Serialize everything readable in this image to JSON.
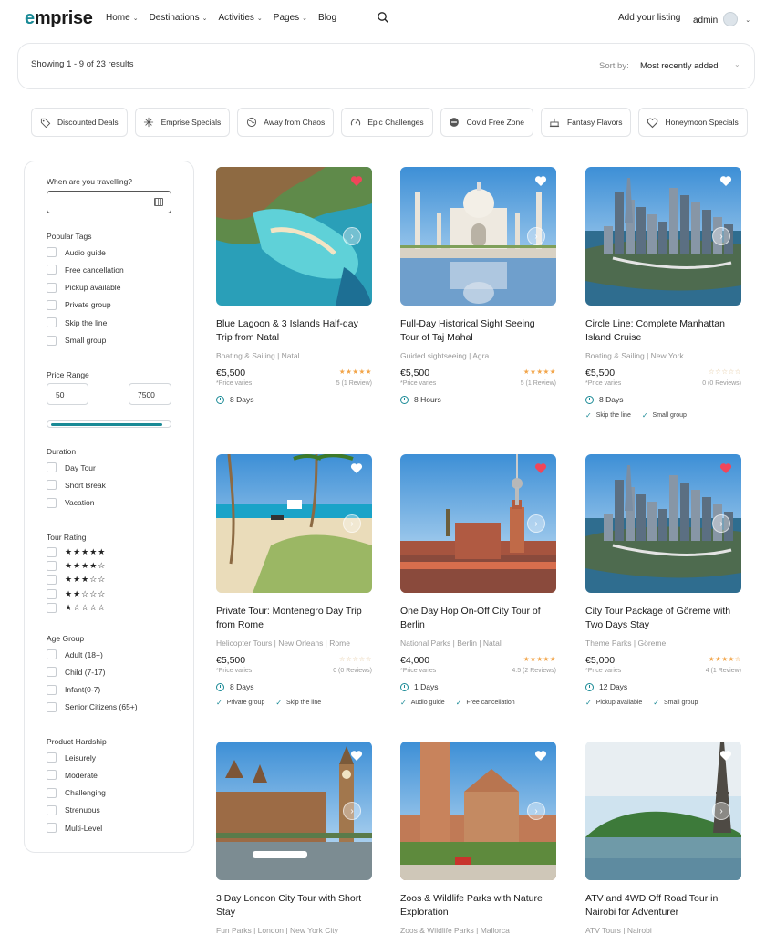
{
  "header": {
    "logo": "emprise",
    "nav": [
      "Home",
      "Destinations",
      "Activities",
      "Pages",
      "Blog"
    ],
    "nav_has_dropdown": [
      true,
      true,
      true,
      true,
      false
    ],
    "add_listing": "Add your listing",
    "user": "admin"
  },
  "results": {
    "summary": "Showing 1 - 9 of 23 results",
    "sort_label": "Sort by:",
    "sort_value": "Most recently added"
  },
  "categories": [
    {
      "label": "Discounted Deals",
      "icon": "tag-icon"
    },
    {
      "label": "Emprise Specials",
      "icon": "sparkle-icon"
    },
    {
      "label": "Away from Chaos",
      "icon": "globe-icon"
    },
    {
      "label": "Epic Challenges",
      "icon": "gauge-icon"
    },
    {
      "label": "Covid Free Zone",
      "icon": "no-entry-icon"
    },
    {
      "label": "Fantasy Flavors",
      "icon": "cake-icon"
    },
    {
      "label": "Honeymoon Specials",
      "icon": "heart-icon"
    }
  ],
  "sidebar": {
    "travel_label": "When are you travelling?",
    "tags_label": "Popular Tags",
    "tags": [
      "Audio guide",
      "Free cancellation",
      "Pickup available",
      "Private group",
      "Skip the line",
      "Small group"
    ],
    "price_label": "Price Range",
    "price_min": "50",
    "price_max": "7500",
    "duration_label": "Duration",
    "durations": [
      "Day Tour",
      "Short Break",
      "Vacation"
    ],
    "rating_label": "Tour Rating",
    "ratings": [
      "★★★★★",
      "★★★★☆",
      "★★★☆☆",
      "★★☆☆☆",
      "★☆☆☆☆"
    ],
    "age_label": "Age Group",
    "ages": [
      "Adult (18+)",
      "Child (7-17)",
      "Infant(0-7)",
      "Senior Citizens (65+)"
    ],
    "hardship_label": "Product Hardship",
    "hardships": [
      "Leisurely",
      "Moderate",
      "Challenging",
      "Strenuous",
      "Multi-Level"
    ]
  },
  "cards": [
    {
      "title": "Blue Lagoon & 3 Islands Half-day Trip from Natal",
      "category": "Boating & Sailing | Natal",
      "price": "€5,500",
      "price_note": "*Price varies",
      "stars": "★★★★★",
      "stars_empty": false,
      "reviews": "5 (1 Review)",
      "duration": "8 Days",
      "features": [],
      "favorited": true,
      "scene": "lagoon"
    },
    {
      "title": "Full-Day Historical Sight Seeing Tour of Taj Mahal",
      "category": "Guided sightseeing | Agra",
      "price": "€5,500",
      "price_note": "*Price varies",
      "stars": "★★★★★",
      "stars_empty": false,
      "reviews": "5 (1 Review)",
      "duration": "8 Hours",
      "features": [],
      "favorited": false,
      "scene": "taj"
    },
    {
      "title": "Circle Line: Complete Manhattan Island Cruise",
      "category": "Boating & Sailing | New York",
      "price": "€5,500",
      "price_note": "*Price varies",
      "stars": "☆☆☆☆☆",
      "stars_empty": true,
      "reviews": "0 (0 Reviews)",
      "duration": "8 Days",
      "features": [
        "Skip the line",
        "Small group"
      ],
      "favorited": false,
      "scene": "city"
    },
    {
      "title": "Private Tour: Montenegro Day Trip from Rome",
      "category": "Helicopter Tours | New Orleans | Rome",
      "price": "€5,500",
      "price_note": "*Price varies",
      "stars": "☆☆☆☆☆",
      "stars_empty": true,
      "reviews": "0 (0 Reviews)",
      "duration": "8 Days",
      "features": [
        "Private group",
        "Skip the line"
      ],
      "favorited": false,
      "scene": "beach"
    },
    {
      "title": "One Day Hop On-Off City Tour of Berlin",
      "category": "National Parks | Berlin | Natal",
      "price": "€4,000",
      "price_note": "*Price varies",
      "stars": "★★★★★",
      "stars_empty": false,
      "reviews": "4.5 (2 Reviews)",
      "duration": "1 Days",
      "features": [
        "Audio guide",
        "Free cancellation"
      ],
      "favorited": true,
      "scene": "berlin"
    },
    {
      "title": "City Tour Package of Göreme with Two Days Stay",
      "category": "Theme Parks | Göreme",
      "price": "€5,000",
      "price_note": "*Price varies",
      "stars": "★★★★☆",
      "stars_empty": false,
      "reviews": "4 (1 Review)",
      "duration": "12 Days",
      "features": [
        "Pickup available",
        "Small group"
      ],
      "favorited": true,
      "scene": "city"
    },
    {
      "title": "3 Day London City Tour with Short Stay",
      "category": "Fun Parks | London | New York City",
      "price": "",
      "price_note": "",
      "stars": "",
      "stars_empty": false,
      "reviews": "",
      "duration": "",
      "features": [],
      "favorited": false,
      "scene": "london"
    },
    {
      "title": "Zoos & Wildlife Parks with Nature Exploration",
      "category": "Zoos & Wildlife Parks | Mallorca",
      "price": "",
      "price_note": "",
      "stars": "",
      "stars_empty": false,
      "reviews": "",
      "duration": "",
      "features": [],
      "favorited": false,
      "scene": "spain"
    },
    {
      "title": "ATV and 4WD Off Road Tour in Nairobi for Adventurer",
      "category": "ATV Tours | Nairobi",
      "price": "",
      "price_note": "",
      "stars": "",
      "stars_empty": false,
      "reviews": "",
      "duration": "",
      "features": [],
      "favorited": false,
      "scene": "paris"
    }
  ],
  "colors": {
    "accent": "#1a8a96",
    "heart_active": "#f0465a",
    "star": "#f2a54a"
  }
}
